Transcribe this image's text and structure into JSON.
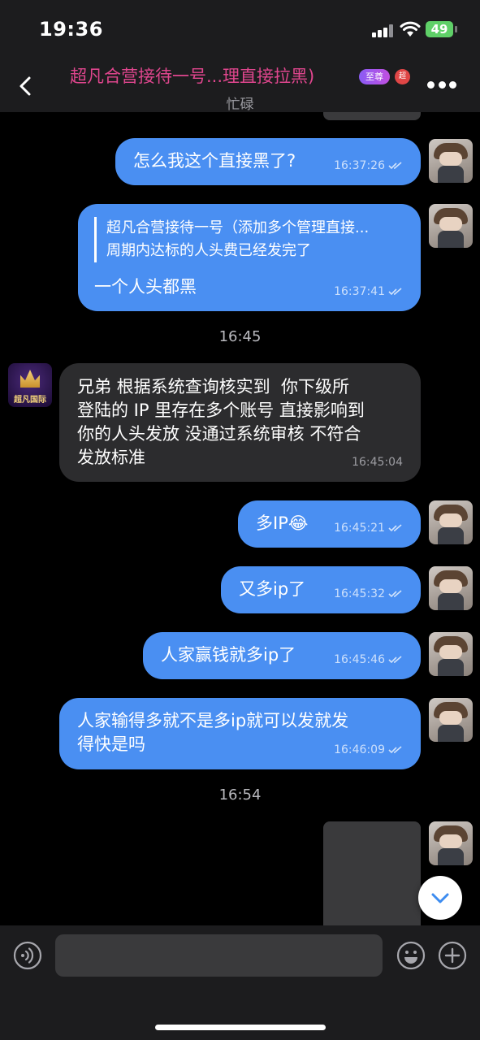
{
  "status_bar": {
    "time": "19:36",
    "battery": "49"
  },
  "header": {
    "title": "超凡合营接待一号...理直接拉黑)",
    "badge_supreme": "至尊",
    "badge_admin": "超",
    "subtitle": "忙碌"
  },
  "messages": [
    {
      "id": "m1",
      "direction": "out",
      "text": "怎么我这个直接黑了?",
      "time": "16:37:26"
    },
    {
      "id": "m2",
      "direction": "out",
      "reply_to": {
        "author": "超凡合营接待一号（添加多个管理直接...",
        "text": "周期内达标的人头费已经发完了"
      },
      "text": "一个人头都黑",
      "time": "16:37:41"
    },
    {
      "id": "m3",
      "direction": "in",
      "text": "兄弟 根据系统查询核实到  你下级所\n登陆的 IP 里存在多个账号 直接影响到\n你的人头发放 没通过系统审核 不符合\n发放标准",
      "time": "16:45:04"
    },
    {
      "id": "m4",
      "direction": "out",
      "text": "多IP😂",
      "time": "16:45:21"
    },
    {
      "id": "m5",
      "direction": "out",
      "text": "又多ip了",
      "time": "16:45:32"
    },
    {
      "id": "m6",
      "direction": "out",
      "text": "人家赢钱就多ip了",
      "time": "16:45:46"
    },
    {
      "id": "m7",
      "direction": "out",
      "text": "人家输得多就不是多ip就可以发就发\n得快是吗",
      "time": "16:46:09"
    }
  ],
  "dividers": [
    "16:45",
    "16:54"
  ],
  "bot_avatar_text": "超凡国际",
  "composer": {
    "placeholder": ""
  },
  "icons": {
    "back": "chevron-left-icon",
    "more": "more-dots-icon",
    "voice": "voice-icon",
    "emoji": "emoji-icon",
    "add": "plus-icon",
    "scroll": "chevron-down-icon",
    "read": "double-check-icon"
  },
  "colors": {
    "outgoing": "#4a8ff2",
    "incoming": "#2c2c2e",
    "title": "#e0468e"
  }
}
